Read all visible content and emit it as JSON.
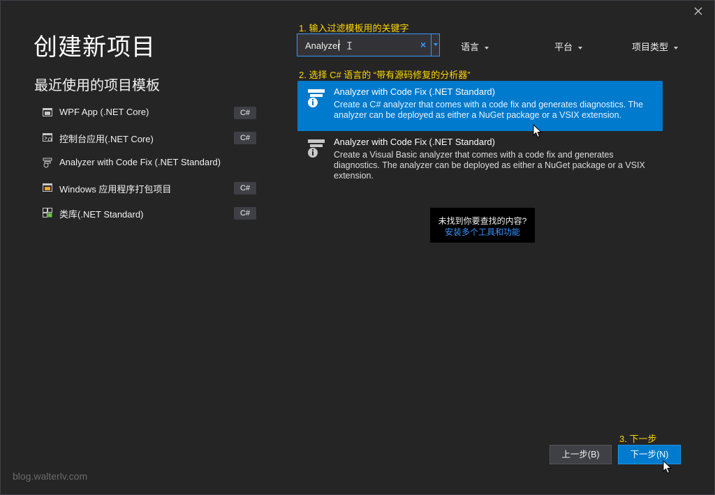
{
  "page": {
    "title": "创建新项目"
  },
  "recent": {
    "title": "最近使用的项目模板",
    "items": [
      {
        "label": "WPF App (.NET Core)",
        "badge": "C#",
        "icon": "wpf-app-icon"
      },
      {
        "label": "控制台应用(.NET Core)",
        "badge": "C#",
        "icon": "console-app-icon"
      },
      {
        "label": "Analyzer with Code Fix (.NET Standard)",
        "badge": "",
        "icon": "analyzer-icon"
      },
      {
        "label": "Windows 应用程序打包项目",
        "badge": "C#",
        "icon": "packaging-project-icon"
      },
      {
        "label": "类库(.NET Standard)",
        "badge": "C#",
        "icon": "class-library-icon"
      }
    ]
  },
  "annotations": {
    "step1": "1. 输入过滤模板用的关键字",
    "step2": "2. 选择 C# 语言的 “带有源码修复的分析器”",
    "step3": "3. 下一步"
  },
  "search": {
    "value": "Analyzer",
    "clear": "×"
  },
  "filters": {
    "language": "语言",
    "platform": "平台",
    "project_type": "项目类型"
  },
  "templates": [
    {
      "name": "Analyzer with Code Fix (.NET Standard)",
      "description": "Create a C# analyzer that comes with a code fix and generates diagnostics. The analyzer can be deployed as either a NuGet package or a VSIX extension.",
      "selected": true
    },
    {
      "name": "Analyzer with Code Fix (.NET Standard)",
      "description": "Create a Visual Basic analyzer that comes with a code fix and generates diagnostics. The analyzer can be deployed as either a NuGet package or a VSIX extension.",
      "selected": false
    }
  ],
  "not_found": {
    "question": "未找到你要查找的内容?",
    "link": "安装多个工具和功能"
  },
  "buttons": {
    "back": "上一步(B)",
    "next": "下一步(N)"
  },
  "watermark": "blog.walterlv.com",
  "colors": {
    "background": "#252526",
    "accent": "#007acc",
    "annotation": "#ffd800",
    "link": "#3794ff"
  }
}
